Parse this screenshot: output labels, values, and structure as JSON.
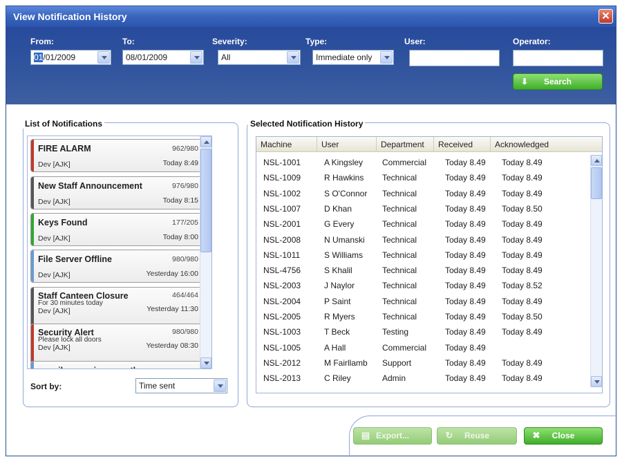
{
  "window": {
    "title": "View Notification History",
    "close_glyph": "✕"
  },
  "filters": {
    "from_label": "From:",
    "from_value_sel": "01",
    "from_value_rest": "/01/2009",
    "to_label": "To:",
    "to_value": "08/01/2009",
    "severity_label": "Severity:",
    "severity_value": "All",
    "type_label": "Type:",
    "type_value": "Immediate only",
    "user_label": "User:",
    "user_value": "",
    "operator_label": "Operator:",
    "operator_value": "",
    "search_label": "Search",
    "search_icon": "download-arrow-icon"
  },
  "notifications": {
    "title": "List of Notifications",
    "items": [
      {
        "title": "FIRE ALARM",
        "count": "962/980",
        "subtitle": "",
        "author": "Dev [AJK]",
        "time": "Today 8:49",
        "color": "#c0392b"
      },
      {
        "title": "New Staff Announcement",
        "count": "976/980",
        "subtitle": "",
        "author": "Dev [AJK]",
        "time": "Today 8:15",
        "color": "#555555"
      },
      {
        "title": "Keys Found",
        "count": "177/205",
        "subtitle": "",
        "author": "Dev [AJK]",
        "time": "Today 8:00",
        "color": "#2ea82e"
      },
      {
        "title": "File Server Offline",
        "count": "980/980",
        "subtitle": "",
        "author": "Dev [AJK]",
        "time": "Yesterday 16:00",
        "color": "#6a9ad0"
      },
      {
        "title": "Staff Canteen Closure",
        "count": "464/464",
        "subtitle": "For 30 minutes today",
        "author": "Dev [AJK]",
        "time": "Yesterday 11:30",
        "color": "#555555"
      },
      {
        "title": "Security Alert",
        "count": "980/980",
        "subtitle": "Please lock all doors",
        "author": "Dev [AJK]",
        "time": "Yesterday 08:30",
        "color": "#c0392b"
      },
      {
        "title": "e-mail server is currently",
        "count": "",
        "subtitle": "",
        "author": "",
        "time": "",
        "color": "#6a9ad0"
      }
    ],
    "sort_label": "Sort by:",
    "sort_value": "Time sent"
  },
  "history": {
    "title": "Selected Notification History",
    "columns": [
      "Machine",
      "User",
      "Department",
      "Received",
      "Acknowledged"
    ],
    "rows": [
      [
        "NSL-1001",
        "A Kingsley",
        "Commercial",
        "Today 8.49",
        "Today 8.49"
      ],
      [
        "NSL-1009",
        "R Hawkins",
        "Technical",
        "Today 8.49",
        "Today 8.49"
      ],
      [
        "NSL-1002",
        "S O'Connor",
        "Technical",
        "Today 8.49",
        "Today 8.49"
      ],
      [
        "NSL-1007",
        "D Khan",
        "Technical",
        "Today 8.49",
        "Today 8.50"
      ],
      [
        "NSL-2001",
        "G Every",
        "Technical",
        "Today 8.49",
        "Today 8.49"
      ],
      [
        "NSL-2008",
        "N Umanski",
        "Technical",
        "Today 8.49",
        "Today 8.49"
      ],
      [
        "NSL-1011",
        "S Williams",
        "Technical",
        "Today 8.49",
        "Today 8.49"
      ],
      [
        "NSL-4756",
        "S Khalil",
        "Technical",
        "Today 8.49",
        "Today 8.49"
      ],
      [
        "NSL-2003",
        "J Naylor",
        "Technical",
        "Today 8.49",
        "Today 8.52"
      ],
      [
        "NSL-2004",
        "P Saint",
        "Technical",
        "Today 8.49",
        "Today 8.49"
      ],
      [
        "NSL-2005",
        "R Myers",
        "Technical",
        "Today 8.49",
        "Today 8.50"
      ],
      [
        "NSL-1003",
        "T Beck",
        "Testing",
        "Today 8.49",
        "Today 8.49"
      ],
      [
        "NSL-1005",
        "A Hall",
        "Commercial",
        "Today 8.49",
        ""
      ],
      [
        "NSL-2012",
        "M Fairllamb",
        "Support",
        "Today 8.49",
        "Today 8.49"
      ],
      [
        "NSL-2013",
        "C Riley",
        "Admin",
        "Today 8.49",
        "Today 8.49"
      ]
    ]
  },
  "footer": {
    "export_label": "Export...",
    "reuse_label": "Reuse",
    "close_label": "Close",
    "close_icon": "✖",
    "reuse_icon": "↻"
  },
  "colors": {
    "accent_green": "#3fae2b",
    "header_blue": "#2b55ad"
  }
}
